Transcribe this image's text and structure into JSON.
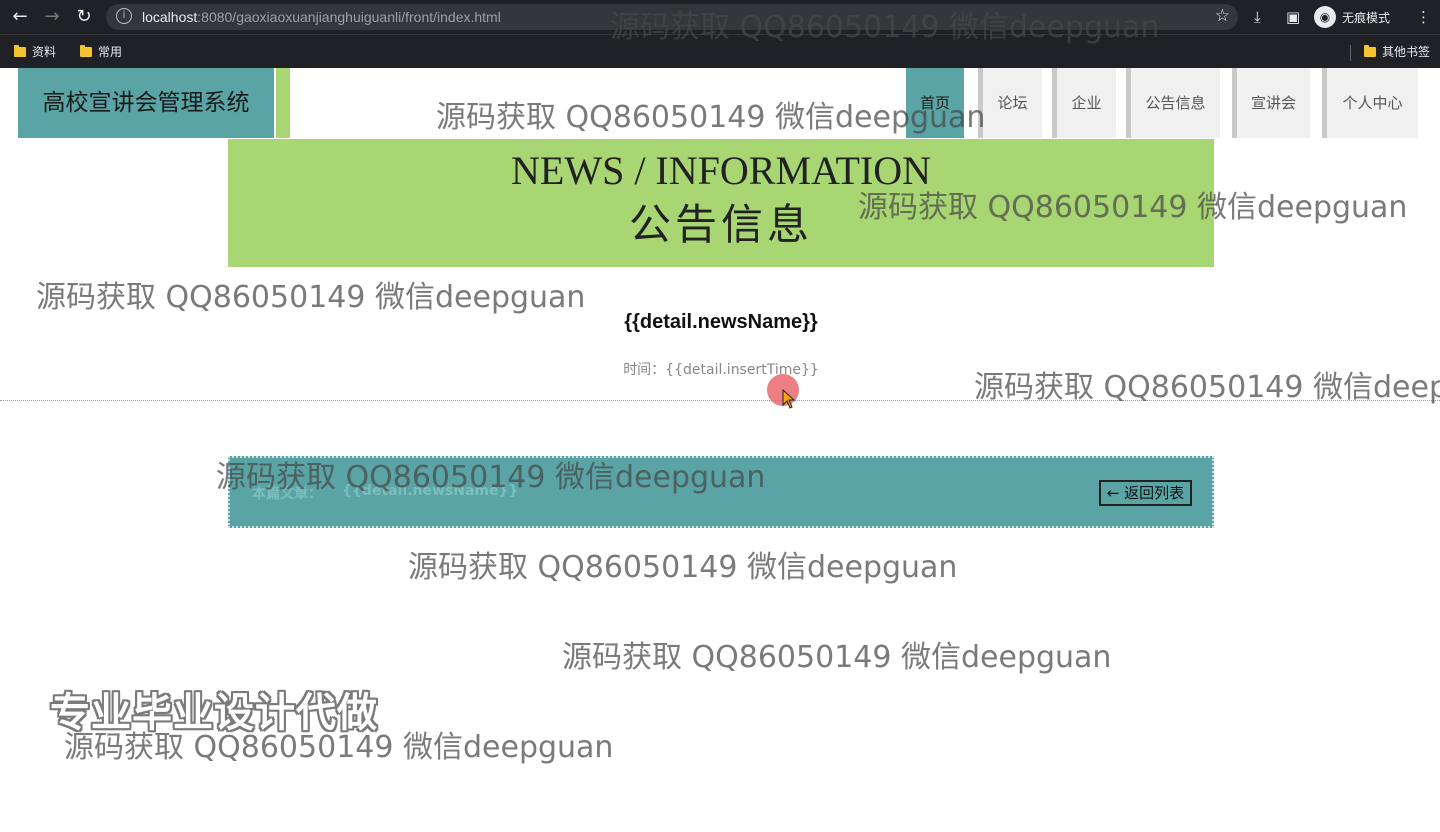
{
  "browser": {
    "url_host": "localhost",
    "url_rest": ":8080/gaoxiaoxuanjianghuiguanli/front/index.html",
    "incognito_label": "无痕模式",
    "bookmarks": [
      "资料",
      "常用"
    ],
    "other_bookmarks": "其他书签"
  },
  "site": {
    "brand": "高校宣讲会管理系统",
    "nav": [
      "首页",
      "论坛",
      "企业",
      "公告信息",
      "宣讲会",
      "个人中心"
    ]
  },
  "banner": {
    "en": "NEWS / INFORMATION",
    "cn": "公告信息"
  },
  "detail": {
    "title": "{{detail.newsName}}",
    "time_label": "时间：{{detail.insertTime}}",
    "article_label": "本篇文章：",
    "article_value": "{{detail.newsName}}",
    "back_button": "返回列表"
  },
  "promo_text": "专业毕业设计代做",
  "watermark": "源码获取 QQ86050149 微信deepguan",
  "colors": {
    "teal": "#5aa4a5",
    "green": "#a8d672"
  }
}
